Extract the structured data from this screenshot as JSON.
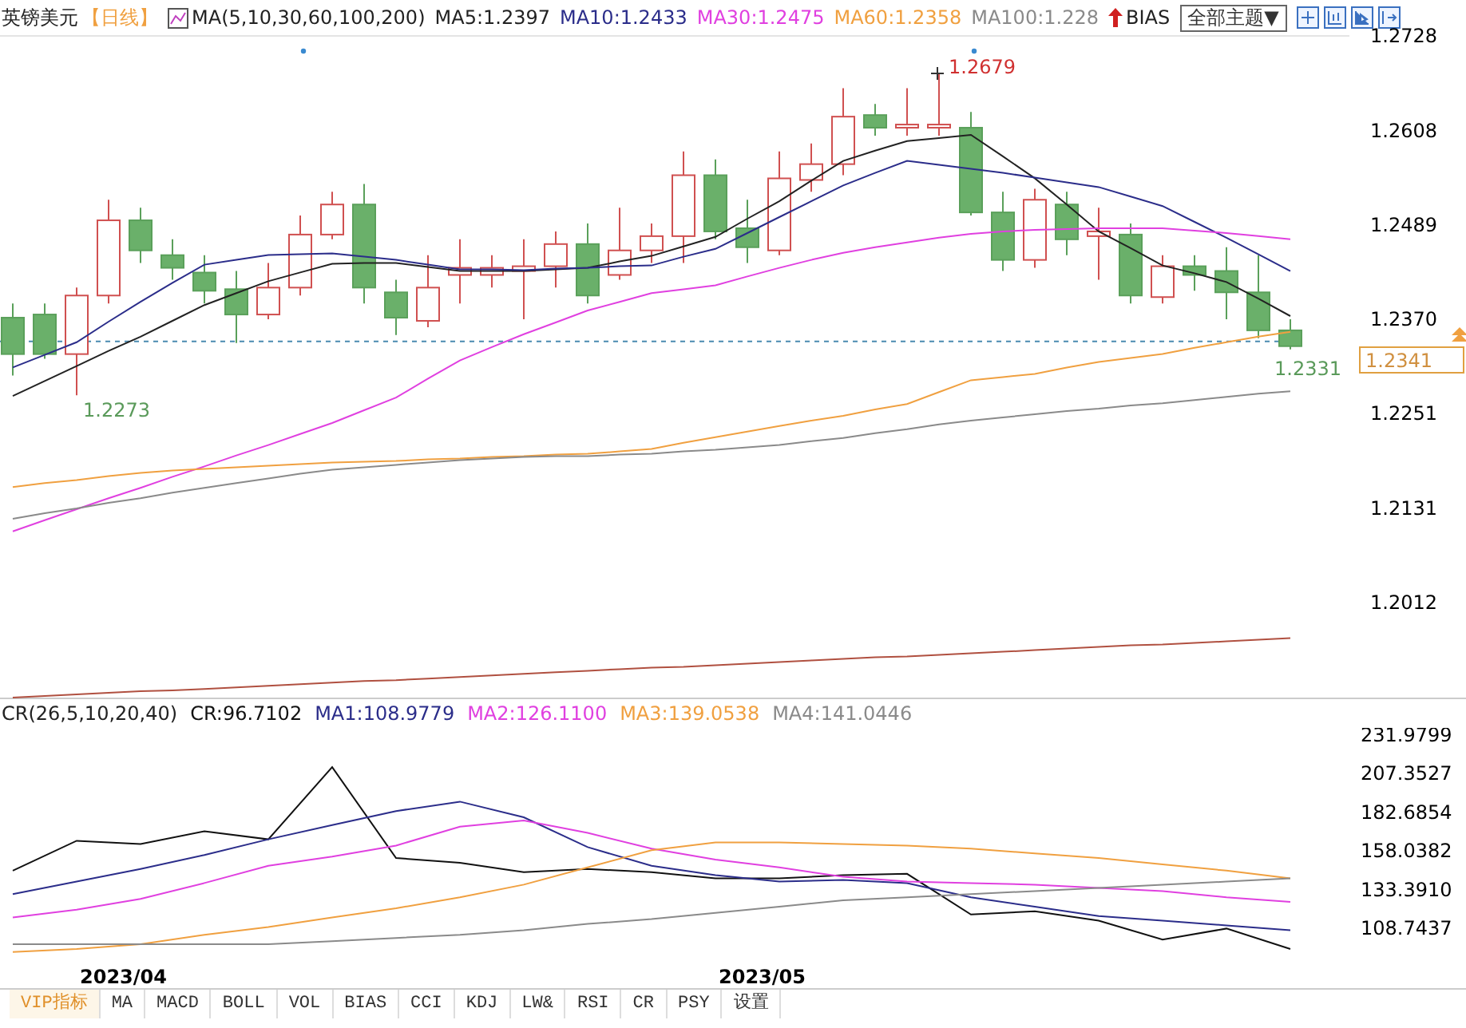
{
  "header": {
    "symbol": "英镑美元",
    "period": "【日线】",
    "indicator": "MA(5,10,30,60,100,200)",
    "ma_values": [
      {
        "label": "MA5:1.2397",
        "color": "#222222"
      },
      {
        "label": "MA10:1.2433",
        "color": "#2b2d8a"
      },
      {
        "label": "MA30:1.2475",
        "color": "#e040e0"
      },
      {
        "label": "MA60:1.2358",
        "color": "#f0a040"
      },
      {
        "label": "MA100:1.228",
        "color": "#8a8a8a"
      }
    ],
    "bias_label": "BIAS",
    "theme_select": "全部主题▼"
  },
  "price_chart": {
    "current_price": "1.2341",
    "annotations": {
      "high": "1.2679",
      "low": "1.2273",
      "last_low": "1.2331"
    },
    "candles": {
      "chart_data": {
        "type": "candlestick",
        "categories": [
          null,
          null,
          null,
          null,
          null,
          null,
          null,
          null,
          null,
          null,
          null,
          null,
          null,
          null,
          null,
          null,
          null,
          null,
          null,
          null,
          null,
          null,
          null,
          null,
          null,
          null,
          null,
          null,
          null,
          null,
          null,
          null,
          null,
          null,
          null,
          null,
          null,
          null,
          null,
          null,
          null
        ],
        "ylim": [
          1.1889,
          1.2728
        ],
        "yticks": [
          {
            "value": 1.2728,
            "label": "1.2728"
          },
          {
            "value": 1.2608,
            "label": "1.2608"
          },
          {
            "value": 1.2489,
            "label": "1.2489"
          },
          {
            "value": 1.237,
            "label": "1.2370"
          }
        ],
        "ref_lines": [
          {
            "axis": "y",
            "value": 1.2341
          }
        ],
        "ohlc": [
          [
            1.2371,
            1.2389,
            1.2298,
            1.2325
          ],
          [
            1.2375,
            1.2389,
            1.2319,
            1.2325
          ],
          [
            1.2325,
            1.2409,
            1.2273,
            1.2399
          ],
          [
            1.2399,
            1.252,
            1.2389,
            1.2494
          ],
          [
            1.2494,
            1.251,
            1.244,
            1.2456
          ],
          [
            1.245,
            1.247,
            1.2419,
            1.2434
          ],
          [
            1.2428,
            1.245,
            1.2389,
            1.2405
          ],
          [
            1.2407,
            1.243,
            1.2339,
            1.2375
          ],
          [
            1.2375,
            1.244,
            1.2369,
            1.2409
          ],
          [
            1.2409,
            1.25,
            1.2399,
            1.2476
          ],
          [
            1.2476,
            1.253,
            1.247,
            1.2514
          ],
          [
            1.2514,
            1.254,
            1.2389,
            1.2409
          ],
          [
            1.2403,
            1.2419,
            1.2349,
            1.2371
          ],
          [
            1.2367,
            1.245,
            1.2359,
            1.2409
          ],
          [
            1.2425,
            1.247,
            1.2389,
            1.2434
          ],
          [
            1.2425,
            1.245,
            1.2409,
            1.2434
          ],
          [
            1.243,
            1.247,
            1.2369,
            1.2436
          ],
          [
            1.2436,
            1.248,
            1.2409,
            1.2464
          ],
          [
            1.2464,
            1.249,
            1.2389,
            1.2399
          ],
          [
            1.2425,
            1.251,
            1.2419,
            1.2456
          ],
          [
            1.2456,
            1.249,
            1.244,
            1.2474
          ],
          [
            1.2474,
            1.2581,
            1.244,
            1.2551
          ],
          [
            1.2551,
            1.2571,
            1.247,
            1.248
          ],
          [
            1.2484,
            1.252,
            1.244,
            1.246
          ],
          [
            1.2456,
            1.2581,
            1.245,
            1.2547
          ],
          [
            1.2545,
            1.2591,
            1.253,
            1.2565
          ],
          [
            1.2565,
            1.2661,
            1.2551,
            1.2625
          ],
          [
            1.2627,
            1.2641,
            1.2601,
            1.2611
          ],
          [
            1.2611,
            1.2661,
            1.2601,
            1.2615
          ],
          [
            1.2611,
            1.2679,
            1.2601,
            1.2615
          ],
          [
            1.2611,
            1.2631,
            1.25,
            1.2504
          ],
          [
            1.2504,
            1.253,
            1.243,
            1.2444
          ],
          [
            1.2444,
            1.2534,
            1.2434,
            1.252
          ],
          [
            1.2514,
            1.253,
            1.245,
            1.247
          ],
          [
            1.2474,
            1.251,
            1.2419,
            1.248
          ],
          [
            1.2476,
            1.249,
            1.2389,
            1.2399
          ],
          [
            1.2397,
            1.245,
            1.2389,
            1.2436
          ],
          [
            1.2436,
            1.245,
            1.2405,
            1.2425
          ],
          [
            1.243,
            1.246,
            1.2369,
            1.2403
          ],
          [
            1.2403,
            1.245,
            1.2345,
            1.2355
          ],
          [
            1.2355,
            1.2369,
            1.2331,
            1.2335
          ]
        ]
      }
    },
    "moving_averages": {
      "chart_data": {
        "type": "line",
        "categories": [
          null,
          null,
          null,
          null,
          null,
          null,
          null,
          null,
          null,
          null,
          null,
          null,
          null,
          null,
          null,
          null,
          null,
          null,
          null,
          null,
          null,
          null,
          null,
          null,
          null,
          null,
          null,
          null,
          null,
          null,
          null,
          null,
          null,
          null,
          null,
          null,
          null,
          null,
          null,
          null,
          null
        ],
        "ylim": [
          1.1889,
          1.2728
        ],
        "yticks": [
          {
            "value": 1.2251,
            "label": "1.2251"
          },
          {
            "value": 1.2131,
            "label": "1.2131"
          },
          {
            "value": 1.2012,
            "label": "1.2012"
          }
        ],
        "series": [
          {
            "color": "#222222",
            "values": [
              1.2272,
              1.2291,
              1.231,
              1.2329,
              1.2347,
              1.2367,
              1.2387,
              1.2402,
              1.2417,
              1.2428,
              1.2439,
              1.244,
              1.244,
              1.2435,
              1.243,
              1.243,
              1.243,
              1.2432,
              1.2434,
              1.2442,
              1.2449,
              1.2461,
              1.2473,
              1.2496,
              1.2518,
              1.2544,
              1.2569,
              1.2582,
              1.2594,
              1.2598,
              1.2602,
              1.2575,
              1.2547,
              1.2514,
              1.248,
              1.2459,
              1.2437,
              1.2427,
              1.2416,
              1.2395,
              1.2373
            ]
          },
          {
            "color": "#2b2d8a",
            "values": [
              1.2308,
              1.2324,
              1.234,
              1.2366,
              1.2391,
              1.2415,
              1.2438,
              1.2444,
              1.245,
              1.2451,
              1.2452,
              1.2448,
              1.2444,
              1.2438,
              1.2432,
              1.2432,
              1.2431,
              1.2433,
              1.2434,
              1.2436,
              1.2437,
              1.2448,
              1.2458,
              1.2478,
              1.2498,
              1.2518,
              1.2538,
              1.2554,
              1.2569,
              1.2564,
              1.2559,
              1.2554,
              1.2548,
              1.2542,
              1.2536,
              1.2524,
              1.2512,
              1.2492,
              1.2472,
              1.2451,
              1.243
            ]
          },
          {
            "color": "#e040e0",
            "values": [
              1.2101,
              1.2115,
              1.2129,
              1.2143,
              1.2156,
              1.217,
              1.2183,
              1.2197,
              1.221,
              1.2224,
              1.2238,
              1.2254,
              1.227,
              1.2294,
              1.2317,
              1.2334,
              1.235,
              1.2365,
              1.238,
              1.2391,
              1.2402,
              1.2407,
              1.2412,
              1.2423,
              1.2434,
              1.2444,
              1.2453,
              1.246,
              1.2466,
              1.2472,
              1.2477,
              1.248,
              1.2482,
              1.2483,
              1.2484,
              1.2484,
              1.2484,
              1.2481,
              1.2478,
              1.2474,
              1.247
            ]
          },
          {
            "color": "#f0a040",
            "values": [
              1.2157,
              1.2162,
              1.2166,
              1.2171,
              1.2175,
              1.2178,
              1.218,
              1.2182,
              1.2184,
              1.2186,
              1.2188,
              1.2189,
              1.219,
              1.2192,
              1.2193,
              1.2195,
              1.2196,
              1.2198,
              1.2199,
              1.2202,
              1.2205,
              1.2213,
              1.222,
              1.2227,
              1.2234,
              1.2241,
              1.2247,
              1.2255,
              1.2262,
              1.2277,
              1.2292,
              1.2296,
              1.23,
              1.2308,
              1.2315,
              1.232,
              1.2325,
              1.2333,
              1.234,
              1.2347,
              1.2353
            ]
          },
          {
            "color": "#8a8a8a",
            "values": [
              1.2117,
              1.2124,
              1.213,
              1.2137,
              1.2143,
              1.215,
              1.2156,
              1.2162,
              1.2168,
              1.2174,
              1.2179,
              1.2182,
              1.2185,
              1.2188,
              1.2191,
              1.2193,
              1.2195,
              1.2196,
              1.2196,
              1.2198,
              1.2199,
              1.2202,
              1.2204,
              1.2207,
              1.221,
              1.2215,
              1.2219,
              1.2225,
              1.223,
              1.2236,
              1.2241,
              1.2245,
              1.2249,
              1.2253,
              1.2256,
              1.226,
              1.2263,
              1.2267,
              1.2271,
              1.2275,
              1.2278
            ]
          },
          {
            "color": "#b05040",
            "values": [
              1.1891,
              1.1893,
              1.1895,
              1.1897,
              1.1899,
              1.19,
              1.1902,
              1.1904,
              1.1906,
              1.1908,
              1.191,
              1.1912,
              1.1913,
              1.1915,
              1.1917,
              1.1919,
              1.1921,
              1.1923,
              1.1925,
              1.1927,
              1.1929,
              1.193,
              1.1932,
              1.1934,
              1.1936,
              1.1938,
              1.194,
              1.1942,
              1.1943,
              1.1945,
              1.1947,
              1.1949,
              1.1951,
              1.1953,
              1.1955,
              1.1957,
              1.1958,
              1.196,
              1.1962,
              1.1964,
              1.1966
            ]
          }
        ]
      }
    }
  },
  "indicator_panel": {
    "title": "CR(26,5,10,20,40)",
    "legend": [
      {
        "label": "CR:96.7102",
        "color": "#111111"
      },
      {
        "label": "MA1:108.9779",
        "color": "#2b2d8a"
      },
      {
        "label": "MA2:126.1100",
        "color": "#e040e0"
      },
      {
        "label": "MA3:139.0538",
        "color": "#f0a040"
      },
      {
        "label": "MA4:141.0446",
        "color": "#8a8a8a"
      }
    ],
    "chart_data": {
      "type": "line",
      "categories": [
        null,
        null,
        null,
        null,
        null,
        null,
        null,
        null,
        null,
        null,
        null,
        null,
        null,
        null,
        null,
        null,
        null,
        null,
        null,
        null,
        null
      ],
      "ylim": [
        69,
        231.9799
      ],
      "yticks": [
        {
          "value": 231.9799,
          "label": "231.9799"
        },
        {
          "value": 207.3527,
          "label": "207.3527"
        },
        {
          "value": 182.6854,
          "label": "182.6854"
        },
        {
          "value": 158.0382,
          "label": "158.0382"
        },
        {
          "value": 133.391,
          "label": "133.3910"
        },
        {
          "value": 108.7437,
          "label": "108.7437"
        }
      ],
      "series": [
        {
          "color": "#111111",
          "values": [
            145,
            164,
            162,
            170,
            165,
            211,
            153,
            150,
            144,
            146,
            144,
            140,
            140,
            142,
            143,
            117,
            119,
            113,
            101,
            108,
            95
          ]
        },
        {
          "color": "#2b2d8a",
          "values": [
            130,
            138,
            146,
            155,
            165,
            174,
            183,
            189,
            179,
            160,
            148,
            142,
            138,
            139,
            137,
            128,
            122,
            116,
            113,
            110,
            107
          ]
        },
        {
          "color": "#e040e0",
          "values": [
            115,
            120,
            127,
            137,
            148,
            154,
            161,
            173,
            177,
            169,
            159,
            152,
            147,
            141,
            138,
            137,
            136,
            134,
            132,
            128,
            125
          ]
        },
        {
          "color": "#f0a040",
          "values": [
            93,
            95,
            98,
            104,
            109,
            115,
            121,
            128,
            136,
            147,
            158,
            163,
            163,
            162,
            161,
            159,
            156,
            153,
            149,
            145,
            140
          ]
        },
        {
          "color": "#8a8a8a",
          "values": [
            98,
            98,
            98,
            98,
            98,
            100,
            102,
            104,
            107,
            111,
            114,
            118,
            122,
            126,
            128,
            130,
            132,
            134,
            136,
            138,
            140
          ]
        }
      ]
    }
  },
  "dates": [
    "2023/04",
    "2023/05"
  ],
  "tabs": [
    {
      "label": "VIP指标",
      "selected": true
    },
    {
      "label": "MA",
      "selected": false
    },
    {
      "label": "MACD",
      "selected": false
    },
    {
      "label": "BOLL",
      "selected": false
    },
    {
      "label": "VOL",
      "selected": false
    },
    {
      "label": "BIAS",
      "selected": false
    },
    {
      "label": "CCI",
      "selected": false
    },
    {
      "label": "KDJ",
      "selected": false
    },
    {
      "label": "LW&",
      "selected": false
    },
    {
      "label": "RSI",
      "selected": false
    },
    {
      "label": "CR",
      "selected": false
    },
    {
      "label": "PSY",
      "selected": false
    },
    {
      "label": "设置",
      "selected": false
    }
  ]
}
